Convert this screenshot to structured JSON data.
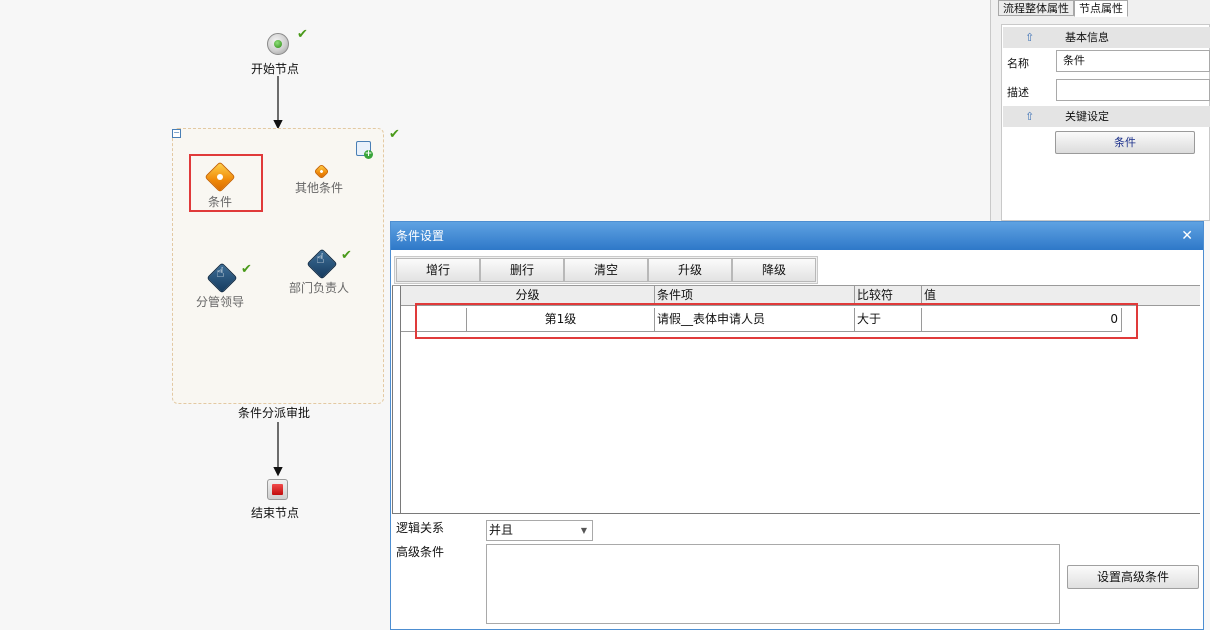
{
  "flow": {
    "start_label": "开始节点",
    "end_label": "结束节点",
    "container_label": "条件分派审批",
    "condition_label": "条件",
    "other_condition_label": "其他条件",
    "leader_label": "分管领导",
    "dept_head_label": "部门负责人",
    "check_mark": "✔"
  },
  "props": {
    "tabs": [
      "流程整体属性",
      "节点属性"
    ],
    "basic_section": "基本信息",
    "key_section": "关键设定",
    "name_label": "名称",
    "name_value": "条件",
    "desc_label": "描述",
    "desc_value": "",
    "condition_button": "条件"
  },
  "dialog": {
    "title": "条件设置",
    "close": "✕",
    "toolbar": [
      "增行",
      "删行",
      "清空",
      "升级",
      "降级"
    ],
    "columns": [
      "分级",
      "条件项",
      "比较符",
      "值"
    ],
    "rows": [
      {
        "level": "第1级",
        "item": "请假__表体申请人员",
        "op": "大于",
        "value": "0"
      }
    ],
    "logic_label": "逻辑关系",
    "logic_value": "并且",
    "advanced_label": "高级条件",
    "advanced_button": "设置高级条件"
  },
  "colors": {
    "accent_blue": "#2e78c8",
    "highlight_red": "#e03a3a",
    "check_green": "#4a9a1a"
  }
}
